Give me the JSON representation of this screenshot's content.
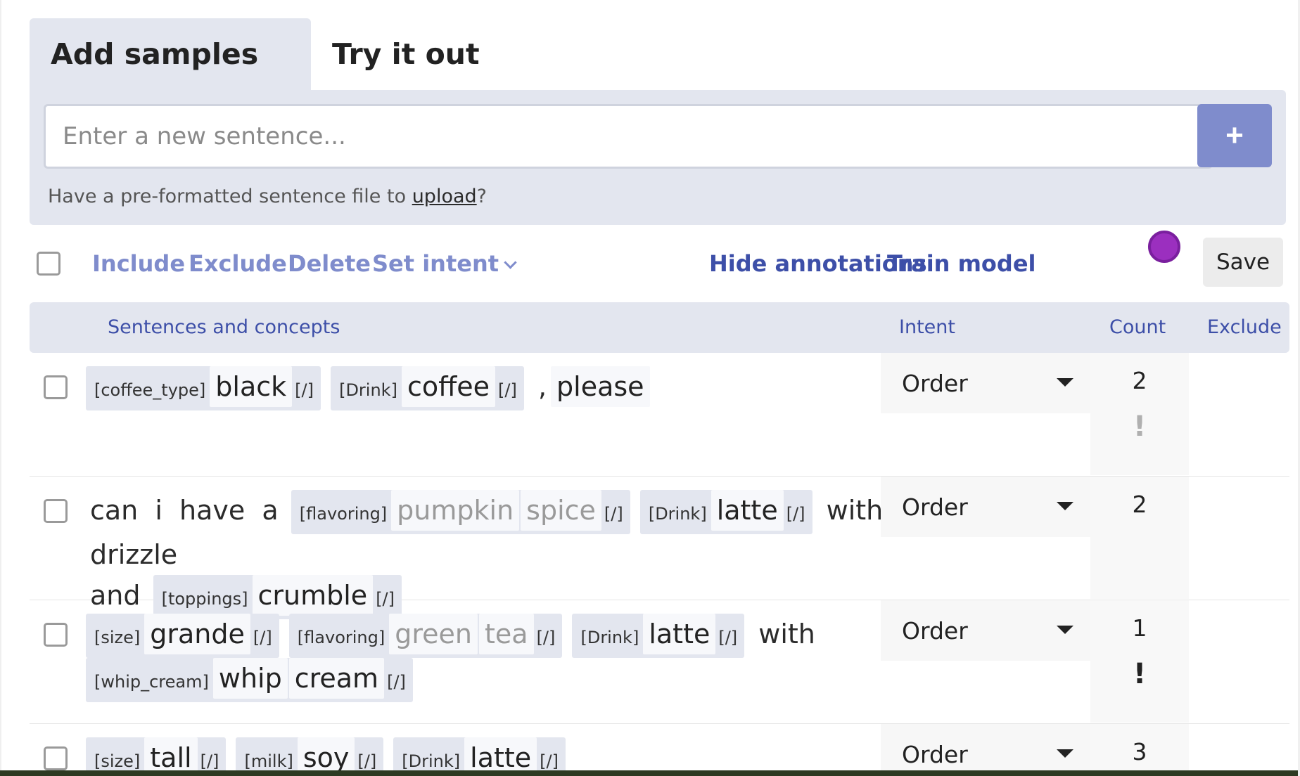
{
  "tabs": [
    {
      "label": "Add samples",
      "active": true
    },
    {
      "label": "Try it out",
      "active": false
    }
  ],
  "add_panel": {
    "placeholder": "Enter a new sentence...",
    "add_button_glyph": "+",
    "upload_prefix": "Have a pre-formatted sentence file to ",
    "upload_link": "upload",
    "upload_suffix": "?"
  },
  "toolbar": {
    "include": "Include",
    "exclude": "Exclude",
    "delete": "Delete",
    "set_intent": "Set intent",
    "hide_annotations": "Hide annotations",
    "train_model": "Train model",
    "save": "Save"
  },
  "table": {
    "headers": {
      "sentences": "Sentences and concepts",
      "intent": "Intent",
      "count": "Count",
      "exclude": "Exclude"
    },
    "rows": [
      {
        "intent": "Order",
        "count": "2",
        "warning": "!",
        "warning_color": "#b0b0b0"
      },
      {
        "intent": "Order",
        "count": "2",
        "warning": "",
        "warning_color": "#222222"
      },
      {
        "intent": "Order",
        "count": "1",
        "warning": "!",
        "warning_color": "#222222"
      },
      {
        "intent": "Order",
        "count": "3",
        "warning": "",
        "warning_color": "#222222"
      }
    ],
    "row1": {
      "t1": "[coffee_type]",
      "w1": "black",
      "c1": "[/]",
      "t2": "[Drink]",
      "w2": "coffee",
      "c2": "[/]",
      "p1": ",",
      "p2": "please"
    },
    "row2": {
      "p1": "can",
      "p2": "i",
      "p3": "have",
      "p4": "a",
      "t1": "[flavoring]",
      "w1": "pumpkin",
      "w2": "spice",
      "c1": "[/]",
      "t2": "[Drink]",
      "w3": "latte",
      "c2": "[/]",
      "p5": "with",
      "p6": "drizzle",
      "p7": "and",
      "t3": "[toppings]",
      "w4": "crumble",
      "c3": "[/]"
    },
    "row3": {
      "t1": "[size]",
      "w1": "grande",
      "c1": "[/]",
      "t2": "[flavoring]",
      "w2": "green",
      "w3": "tea",
      "c2": "[/]",
      "t3": "[Drink]",
      "w4": "latte",
      "c3": "[/]",
      "p1": "with",
      "t4": "[whip_cream]",
      "w5": "whip",
      "w6": "cream",
      "c4": "[/]"
    },
    "row4": {
      "t1": "[size]",
      "w1": "tall",
      "c1": "[/]",
      "t2": "[milk]",
      "w2": "soy",
      "c2": "[/]",
      "t3": "[Drink]",
      "w3": "latte",
      "c3": "[/]"
    }
  },
  "colors": {
    "accent": "#7f8ccc",
    "accent_strong": "#3d4fa8",
    "panel": "#e3e6ef",
    "badge_dot": "#9b2fbf"
  }
}
